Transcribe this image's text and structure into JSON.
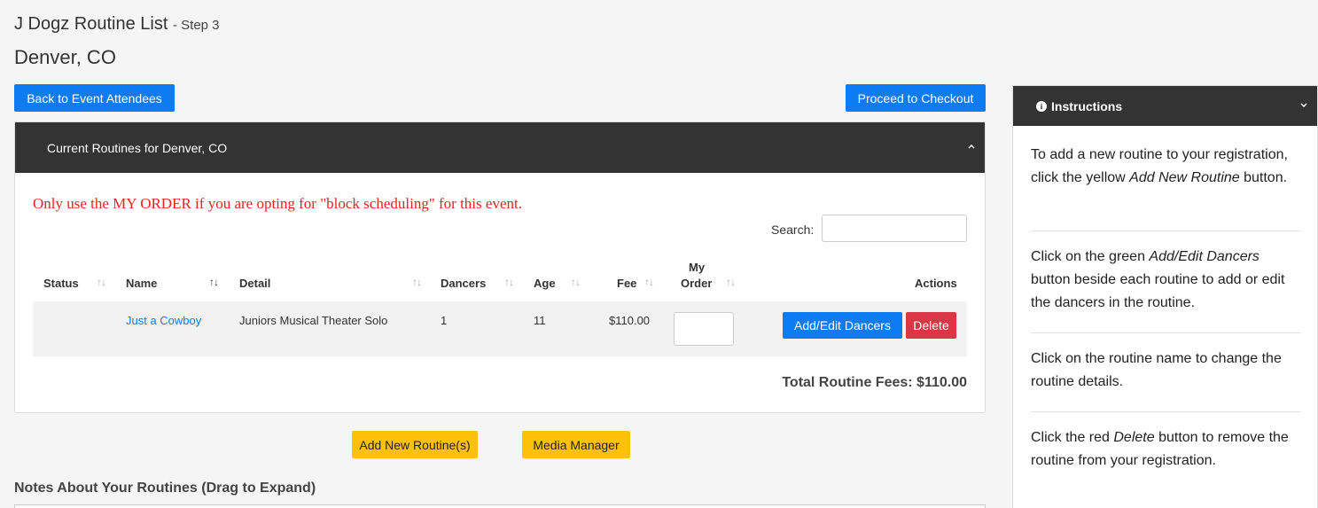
{
  "header": {
    "title": "J Dogz Routine List",
    "step": "- Step 3",
    "location": "Denver, CO"
  },
  "buttons": {
    "back": "Back to Event Attendees",
    "checkout": "Proceed to Checkout",
    "add_routine": "Add New Routine(s)",
    "media_manager": "Media Manager",
    "add_edit_dancers": "Add/Edit Dancers",
    "delete": "Delete"
  },
  "panel": {
    "title": "Current Routines for Denver, CO",
    "warning": "Only use the MY ORDER if you are opting for \"block scheduling\" for this event.",
    "search_label": "Search:",
    "search_value": "",
    "total": "Total Routine Fees: $110.00"
  },
  "table": {
    "columns": [
      "Status",
      "Name",
      "Detail",
      "Dancers",
      "Age",
      "Fee",
      "My",
      "Order",
      "Actions"
    ],
    "rows": [
      {
        "status": "",
        "name": "Just a Cowboy",
        "detail": "Juniors Musical Theater Solo",
        "dancers": "1",
        "age": "11",
        "fee": "$110.00",
        "my_order": ""
      }
    ]
  },
  "notes": {
    "title": "Notes About Your Routines (Drag to Expand)"
  },
  "instructions": {
    "title": "Instructions",
    "p1_a": "To add a new routine to your registration, click the yellow ",
    "p1_em": "Add New Routine",
    "p1_b": " button.",
    "p2_a": "Click on the green ",
    "p2_em": "Add/Edit Dancers",
    "p2_b": " button beside each routine to add or edit the dancers in the routine.",
    "p3": "Click on the routine name to change the routine details.",
    "p4_a": "Click the red ",
    "p4_em": "Delete",
    "p4_b": " button to remove the routine from your registration."
  },
  "colors": {
    "primary": "#0d7cf2",
    "danger": "#dc3545",
    "warning_btn": "#ffc107",
    "header_dark": "#333333",
    "warning_text": "#e8231b"
  },
  "icons": [
    "chevron-up-icon",
    "chevron-down-icon",
    "info-icon",
    "sort-icon"
  ]
}
